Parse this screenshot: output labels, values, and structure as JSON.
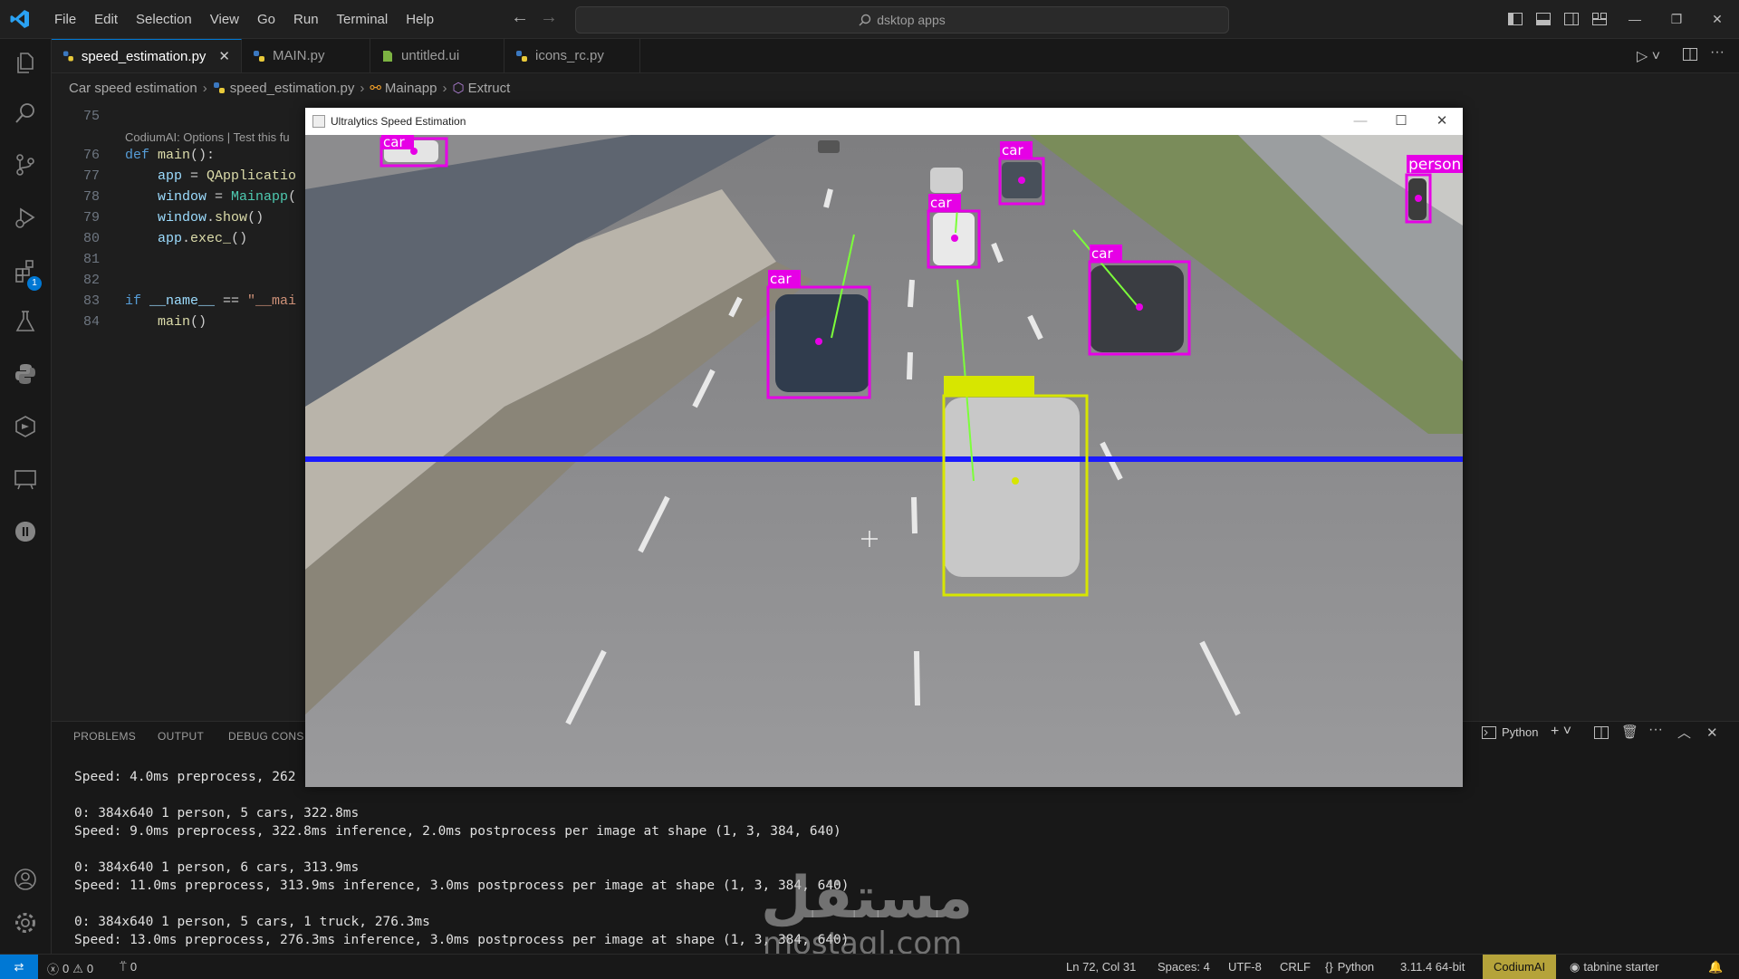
{
  "menu": [
    "File",
    "Edit",
    "Selection",
    "View",
    "Go",
    "Run",
    "Terminal",
    "Help"
  ],
  "command_center": {
    "text": "dsktop apps"
  },
  "tabs": [
    {
      "label": "speed_estimation.py",
      "active": true,
      "icon": "python-icon"
    },
    {
      "label": "MAIN.py",
      "active": false,
      "icon": "python-icon"
    },
    {
      "label": "untitled.ui",
      "active": false,
      "icon": "file-icon"
    },
    {
      "label": "icons_rc.py",
      "active": false,
      "icon": "python-icon"
    }
  ],
  "breadcrumb": [
    "Car speed estimation",
    "speed_estimation.py",
    "Mainapp",
    "Extruct"
  ],
  "editor": {
    "codelens": "CodiumAI: Options | Test this fu",
    "lines": [
      {
        "n": "75",
        "code": ""
      },
      {
        "n": "76",
        "code": "def main():"
      },
      {
        "n": "77",
        "code": "    app = QApplicatio"
      },
      {
        "n": "78",
        "code": "    window = Mainapp("
      },
      {
        "n": "79",
        "code": "    window.show()"
      },
      {
        "n": "80",
        "code": "    app.exec_()"
      },
      {
        "n": "81",
        "code": ""
      },
      {
        "n": "82",
        "code": ""
      },
      {
        "n": "83",
        "code": "if __name__ == \"__mai"
      },
      {
        "n": "84",
        "code": "    main()"
      }
    ]
  },
  "activity_badge": "1",
  "panel": {
    "tabs": [
      "PROBLEMS",
      "OUTPUT",
      "DEBUG CONS"
    ],
    "shell_label": "Python",
    "terminal_lines": [
      "Speed: 4.0ms preprocess, 262",
      "",
      "0: 384x640 1 person, 5 cars, 322.8ms",
      "Speed: 9.0ms preprocess, 322.8ms inference, 2.0ms postprocess per image at shape (1, 3, 384, 640)",
      "",
      "0: 384x640 1 person, 6 cars, 313.9ms",
      "Speed: 11.0ms preprocess, 313.9ms inference, 3.0ms postprocess per image at shape (1, 3, 384, 640)",
      "",
      "0: 384x640 1 person, 5 cars, 1 truck, 276.3ms",
      "Speed: 13.0ms preprocess, 276.3ms inference, 3.0ms postprocess per image at shape (1, 3, 384, 640)"
    ]
  },
  "video_window": {
    "title": "Ultralytics Speed Estimation",
    "detections": [
      {
        "label": "car",
        "color": "#e600e6"
      },
      {
        "label": "car",
        "color": "#e600e6"
      },
      {
        "label": "car",
        "color": "#e600e6"
      },
      {
        "label": "car",
        "color": "#e600e6"
      },
      {
        "label": "car",
        "color": "#e600e6"
      },
      {
        "label": "person",
        "color": "#e600e6"
      },
      {
        "label": "",
        "color": "#d7e600"
      }
    ],
    "line_color": "#1a1aff"
  },
  "watermark": {
    "arabic": "مستقل",
    "latin": "mostaql.com"
  },
  "status": {
    "errors": "0",
    "warnings": "0",
    "ports": "0",
    "position": "Ln 72, Col 31",
    "spaces": "Spaces: 4",
    "encoding": "UTF-8",
    "eol": "CRLF",
    "language": "Python",
    "interpreter": "3.11.4 64-bit",
    "codium": "CodiumAI",
    "tabnine": "tabnine starter"
  },
  "colors": {
    "accent": "#0078d4",
    "codium_bg": "#b5a33a",
    "box_magenta": "#e600e6",
    "box_yellow": "#d7e600"
  }
}
